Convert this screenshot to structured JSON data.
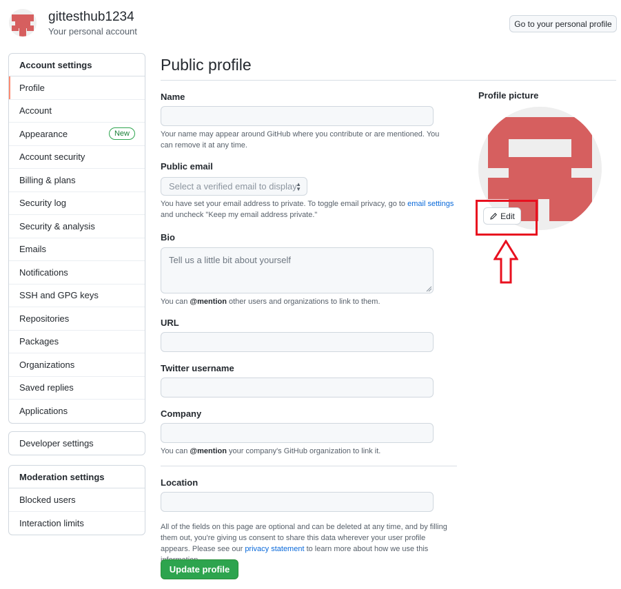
{
  "header": {
    "username": "gittesthub1234",
    "subtitle": "Your personal account",
    "profile_button": "Go to your personal profile"
  },
  "sidebar": {
    "account_settings_title": "Account settings",
    "items": [
      {
        "label": "Profile",
        "selected": true
      },
      {
        "label": "Account"
      },
      {
        "label": "Appearance",
        "badge": "New"
      },
      {
        "label": "Account security"
      },
      {
        "label": "Billing & plans"
      },
      {
        "label": "Security log"
      },
      {
        "label": "Security & analysis"
      },
      {
        "label": "Emails"
      },
      {
        "label": "Notifications"
      },
      {
        "label": "SSH and GPG keys"
      },
      {
        "label": "Repositories"
      },
      {
        "label": "Packages"
      },
      {
        "label": "Organizations"
      },
      {
        "label": "Saved replies"
      },
      {
        "label": "Applications"
      }
    ],
    "developer_settings": "Developer settings",
    "moderation_title": "Moderation settings",
    "moderation_items": [
      {
        "label": "Blocked users"
      },
      {
        "label": "Interaction limits"
      }
    ]
  },
  "main": {
    "title": "Public profile",
    "name_label": "Name",
    "name_value": "",
    "name_note": "Your name may appear around GitHub where you contribute or are mentioned. You can remove it at any time.",
    "email_label": "Public email",
    "email_select": "Select a verified email to display",
    "email_note_pre": "You have set your email address to private. To toggle email privacy, go to ",
    "email_note_link": "email settings",
    "email_note_post": " and uncheck \"Keep my email address private.\"",
    "bio_label": "Bio",
    "bio_placeholder": "Tell us a little bit about yourself",
    "bio_note_pre": "You can ",
    "bio_note_mention": "@mention",
    "bio_note_post": " other users and organizations to link to them.",
    "url_label": "URL",
    "twitter_label": "Twitter username",
    "company_label": "Company",
    "company_note_pre": "You can ",
    "company_note_mention": "@mention",
    "company_note_post": " your company's GitHub organization to link it.",
    "location_label": "Location",
    "footer_note_pre": "All of the fields on this page are optional and can be deleted at any time, and by filling them out, you're giving us consent to share this data wherever your user profile appears. Please see our ",
    "footer_note_link": "privacy statement",
    "footer_note_post": " to learn more about how we use this information.",
    "update_button": "Update profile"
  },
  "profile_picture": {
    "label": "Profile picture",
    "edit_button": "Edit",
    "edit_icon": "pencil-icon",
    "avatar_color": "#d65f5f",
    "annotation_color": "#e8101f"
  }
}
